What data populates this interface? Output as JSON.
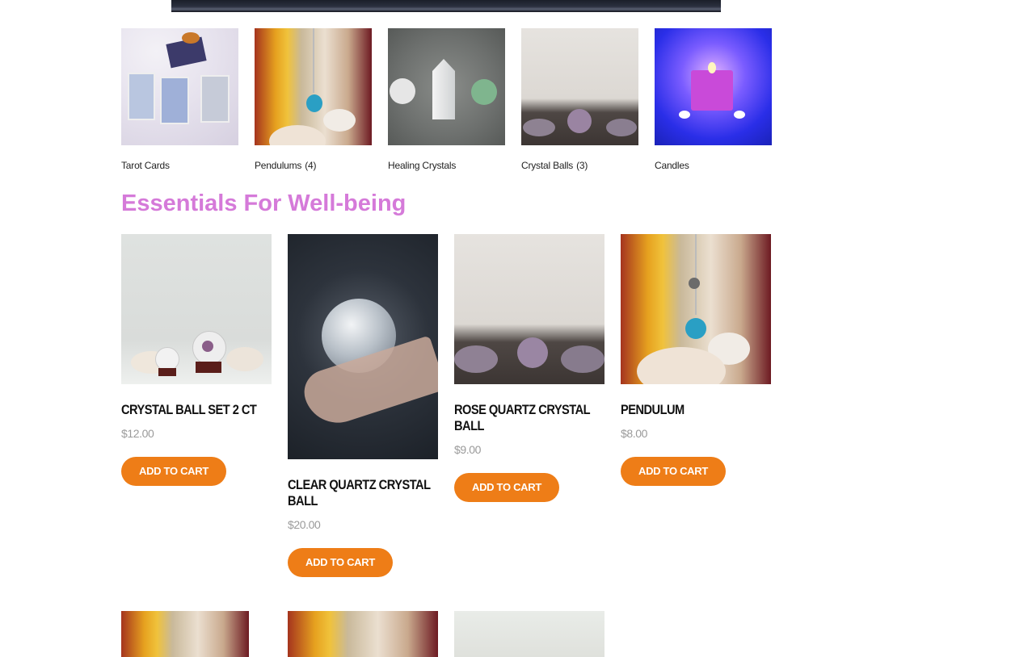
{
  "categories": [
    {
      "label": "Tarot Cards",
      "count": ""
    },
    {
      "label": "Pendulums",
      "count": "(4)"
    },
    {
      "label": "Healing Crystals",
      "count": ""
    },
    {
      "label": "Crystal Balls",
      "count": "(3)"
    },
    {
      "label": "Candles",
      "count": ""
    }
  ],
  "section_title": "Essentials For Well-being",
  "products": [
    {
      "name": "CRYSTAL BALL SET 2 CT",
      "price": "$12.00",
      "button": "ADD TO CART"
    },
    {
      "name": "CLEAR QUARTZ CRYSTAL BALL",
      "price": "$20.00",
      "button": "ADD TO CART"
    },
    {
      "name": "ROSE QUARTZ CRYSTAL BALL",
      "price": "$9.00",
      "button": "ADD TO CART"
    },
    {
      "name": "PENDULUM",
      "price": "$8.00",
      "button": "ADD TO CART"
    }
  ],
  "colors": {
    "accent_title": "#d57ad9",
    "button": "#ee7d17",
    "price": "#9a9a9a"
  }
}
